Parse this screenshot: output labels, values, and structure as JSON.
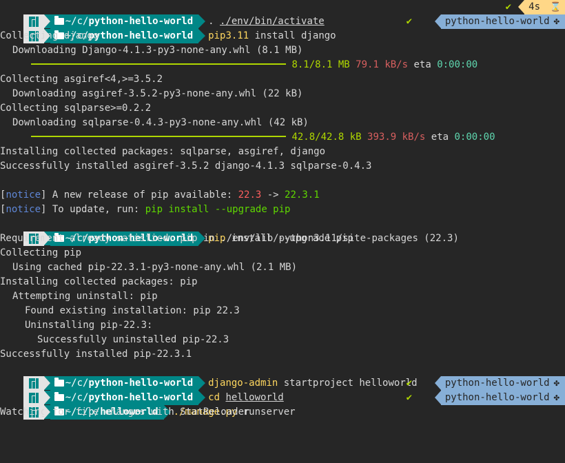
{
  "prompts": [
    {
      "path_prefix": "~/c/",
      "path_dir": "python-hello-world",
      "cmd_pre": ". ",
      "cmd_arg": "./env/bin/activate",
      "duration": "4s"
    },
    {
      "path_prefix": "~/c/",
      "path_dir": "python-hello-world",
      "cmd_pre": "pip3.11",
      "cmd_arg": " install django",
      "status": "✔",
      "venv": "python-hello-world"
    },
    {
      "path_prefix": "~/c/",
      "path_dir": "python-hello-world",
      "cmd_pre": "pip",
      "cmd_arg": " install --upgrade pip"
    },
    {
      "path_prefix": "~/c/",
      "path_dir": "python-hello-world",
      "cmd_pre": "django-admin",
      "cmd_arg": " startproject helloworld"
    },
    {
      "path_prefix": "~/c/",
      "path_dir": "python-hello-world",
      "cmd_pre": "cd ",
      "cmd_arg": "helloworld",
      "status": "✔",
      "venv": "python-hello-world"
    },
    {
      "path_prefix": "~/c/p/",
      "path_dir": "helloworld",
      "cmd_pre": "./manage.py",
      "cmd_arg": " runserver",
      "status": "✔",
      "venv": "python-hello-world"
    }
  ],
  "status_check": "✔",
  "output": {
    "collecting_django": "Collecting django",
    "downloading_django": "Downloading Django-4.1.3-py3-none-any.whl (8.1 MB)",
    "progress1": {
      "size": "8.1/8.1 MB",
      "speed": "79.1 kB/s",
      "eta_label": "eta",
      "eta": "0:00:00"
    },
    "collecting_asgiref": "Collecting asgiref<4,>=3.5.2",
    "downloading_asgiref": "Downloading asgiref-3.5.2-py3-none-any.whl (22 kB)",
    "collecting_sqlparse": "Collecting sqlparse>=0.2.2",
    "downloading_sqlparse": "Downloading sqlparse-0.4.3-py3-none-any.whl (42 kB)",
    "progress2": {
      "size": "42.8/42.8 kB",
      "speed": "393.9 kB/s",
      "eta_label": "eta",
      "eta": "0:00:00"
    },
    "installing1": "Installing collected packages: sqlparse, asgiref, django",
    "success1": "Successfully installed asgiref-3.5.2 django-4.1.3 sqlparse-0.4.3",
    "notice1": {
      "tag_open": "[",
      "tag": "notice",
      "tag_close": "]",
      "text": " A new release of pip available: ",
      "old": "22.3",
      "arrow": " -> ",
      "new": "22.3.1"
    },
    "notice2": {
      "tag_open": "[",
      "tag": "notice",
      "tag_close": "]",
      "text": " To update, run: ",
      "cmd": "pip install --upgrade pip"
    },
    "req_satisfied": "Requirement already satisfied: pip in ./env/lib/python3.11/site-packages (22.3)",
    "collecting_pip": "Collecting pip",
    "using_cached": "Using cached pip-22.3.1-py3-none-any.whl (2.1 MB)",
    "installing2": "Installing collected packages: pip",
    "attempting": "Attempting uninstall: pip",
    "found_existing": "Found existing installation: pip 22.3",
    "uninstalling": "Uninstalling pip-22.3:",
    "success_uninstall": "Successfully uninstalled pip-22.3",
    "success2": "Successfully installed pip-22.3.1",
    "watching": "Watching for file changes with StatReloader"
  },
  "colors": {
    "path_bg": "#008787",
    "venv_bg": "#87afd7",
    "duration_bg": "#ffd787",
    "check": "#afd700",
    "bar": "#afd700"
  },
  "icons": {
    "os": "manjaro-logo-icon",
    "folder": "folder-icon",
    "duration": "hourglass-icon",
    "venv": "python-venv-icon"
  }
}
